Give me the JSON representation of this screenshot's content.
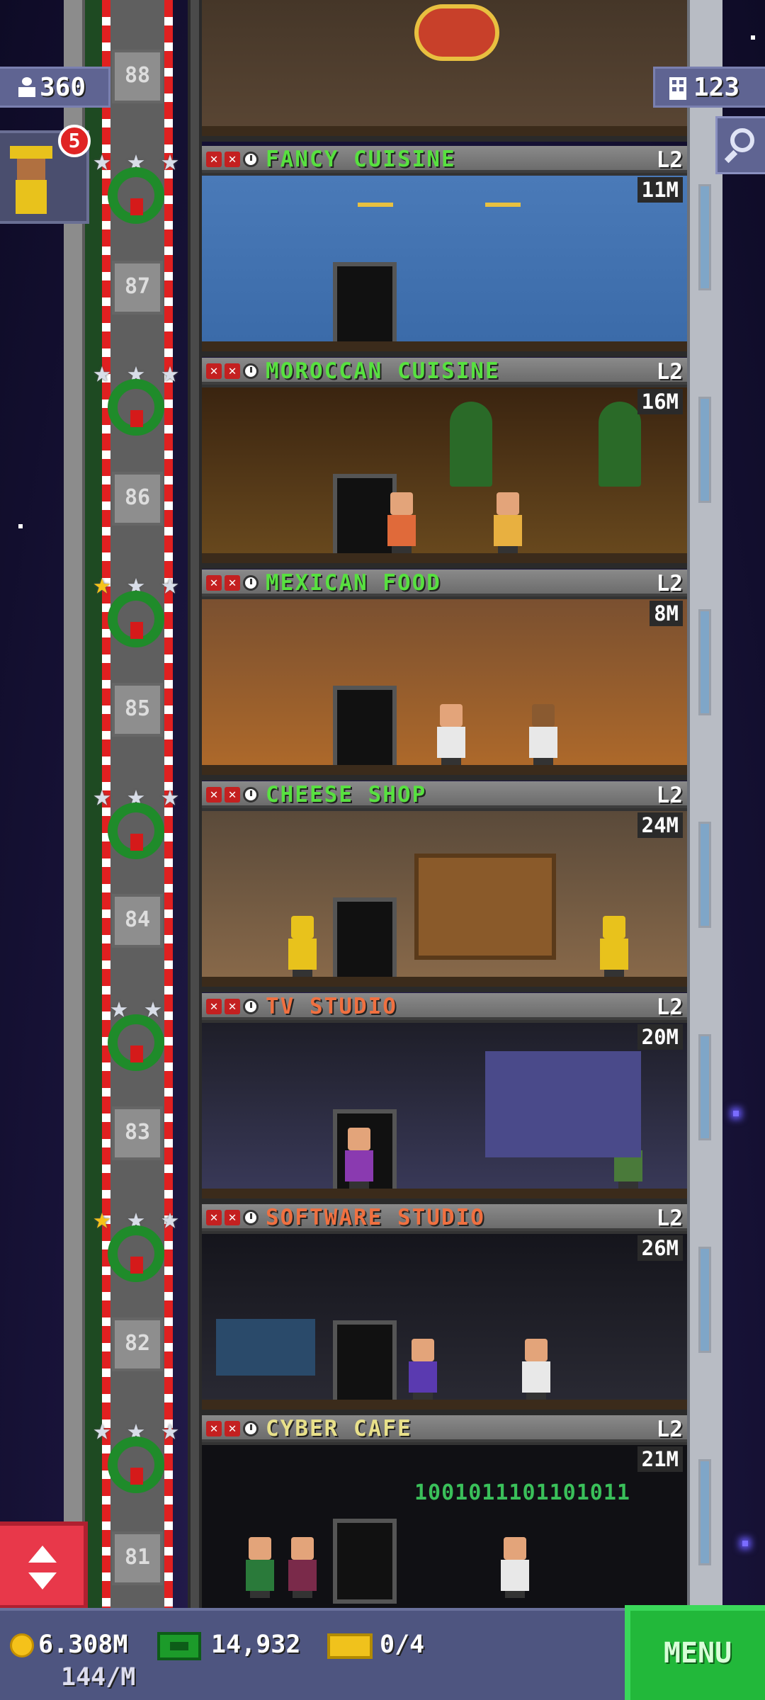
{
  "hud": {
    "population": "360",
    "floors": "123",
    "vip_count": "5"
  },
  "floors": [
    {
      "number": "88",
      "name": "",
      "level": "",
      "earnings": ""
    },
    {
      "number": "87",
      "name": "FANCY CUISINE",
      "level": "L2",
      "earnings": "11M",
      "name_color": "#58e040"
    },
    {
      "number": "86",
      "name": "MOROCCAN CUISINE",
      "level": "L2",
      "earnings": "16M",
      "name_color": "#58e040"
    },
    {
      "number": "85",
      "name": "MEXICAN FOOD",
      "level": "L2",
      "earnings": "8M",
      "name_color": "#58e040"
    },
    {
      "number": "84",
      "name": "CHEESE SHOP",
      "level": "L2",
      "earnings": "24M",
      "name_color": "#58e040"
    },
    {
      "number": "83",
      "name": "TV STUDIO",
      "level": "L2",
      "earnings": "20M",
      "name_color": "#f07040"
    },
    {
      "number": "82",
      "name": "SOFTWARE STUDIO",
      "level": "L2",
      "earnings": "26M",
      "name_color": "#f07040"
    },
    {
      "number": "81",
      "name": "CYBER CAFE",
      "level": "L2",
      "earnings": "21M",
      "name_color": "#e8e08a"
    }
  ],
  "cyber_cafe_screen_text": "1001011101101011",
  "bottom_bar": {
    "coins": "6.308M",
    "coins_rate": "144/M",
    "bux": "14,932",
    "tickets": "0/4",
    "menu_label": "MENU"
  },
  "colors": {
    "green_text": "#58e040",
    "orange_text": "#f07040",
    "yellow_text": "#e8e08a",
    "menu_green": "#22b83a"
  }
}
